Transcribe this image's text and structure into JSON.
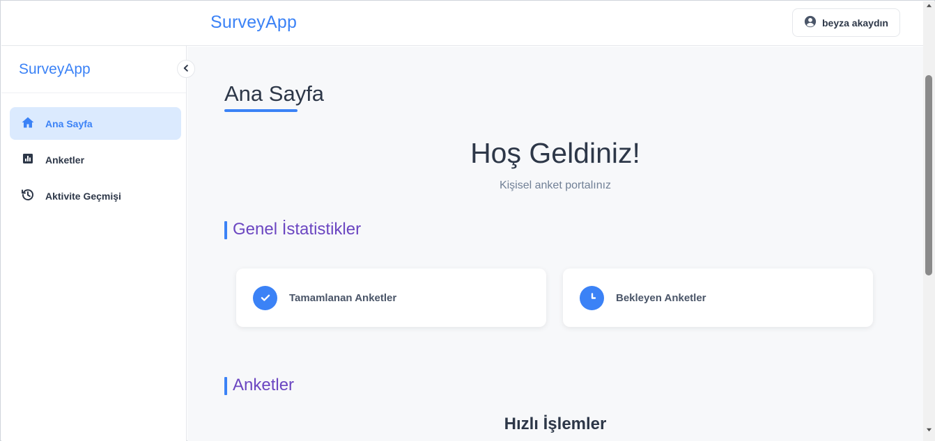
{
  "header": {
    "brand": "SurveyApp",
    "user_name": "beyza akaydın",
    "user_icon": "user-circle-icon"
  },
  "sidebar": {
    "brand": "SurveyApp",
    "collapse_icon": "chevron-left-icon",
    "items": [
      {
        "label": "Ana Sayfa",
        "icon": "home-icon",
        "active": true
      },
      {
        "label": "Anketler",
        "icon": "bar-chart-icon",
        "active": false
      },
      {
        "label": "Aktivite Geçmişi",
        "icon": "history-icon",
        "active": false
      }
    ]
  },
  "main": {
    "page_title": "Ana Sayfa",
    "welcome_title": "Hoş Geldiniz!",
    "welcome_subtitle": "Kişisel anket portalınız",
    "stats_section_title": "Genel İstatistikler",
    "stats": [
      {
        "label": "Tamamlanan Anketler",
        "icon": "check-circle-icon"
      },
      {
        "label": "Bekleyen Anketler",
        "icon": "clock-icon"
      }
    ],
    "surveys_section_title": "Anketler",
    "quick_actions_title": "Hızlı İşlemler"
  },
  "colors": {
    "accent": "#3b82f6",
    "section_title": "#6b46c1",
    "active_bg": "#dbeafe",
    "main_bg": "#f7f8fa"
  }
}
